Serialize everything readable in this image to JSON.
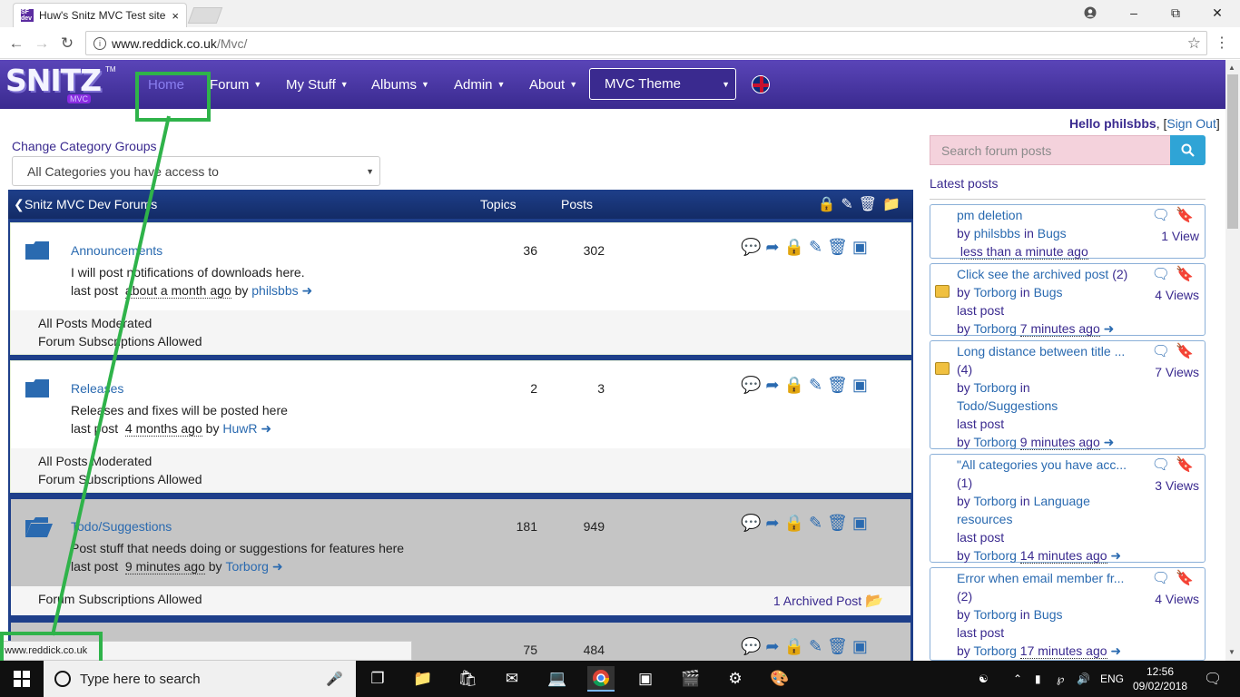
{
  "browser": {
    "tab_title": "Huw's Snitz MVC Test site",
    "tab_close": "×",
    "favicon": "SF dev",
    "url_host": "www.reddick.co.uk",
    "url_path": "/Mvc/",
    "status_url": "www.reddick.co.uk"
  },
  "site": {
    "logo_text": "SNITZ",
    "logo_sub": "MVC",
    "logo_tm": "TM",
    "nav": [
      {
        "label": "Home"
      },
      {
        "label": "Forum"
      },
      {
        "label": "My Stuff"
      },
      {
        "label": "Albums"
      },
      {
        "label": "Admin"
      },
      {
        "label": "About"
      }
    ],
    "theme_select": "MVC Theme"
  },
  "main": {
    "change_category_label": "Change Category Groups",
    "category_select": "All Categories you have access to",
    "forum_group_title": "Snitz MVC Dev Forums",
    "col_topics": "Topics",
    "col_posts": "Posts",
    "forums": [
      {
        "name": "Announcements",
        "description": "I will post notifications of downloads here.",
        "last_post_label": "last post",
        "last_post_time": "about a month ago",
        "by": "by",
        "last_post_user": "philsbbs",
        "topics": "36",
        "posts": "302",
        "footer_lines": [
          "All Posts Moderated",
          "Forum Subscriptions Allowed"
        ]
      },
      {
        "name": "Releases",
        "description": "Releases and fixes will be posted here",
        "last_post_label": "last post",
        "last_post_time": "4 months ago",
        "by": "by",
        "last_post_user": "HuwR",
        "topics": "2",
        "posts": "3",
        "footer_lines": [
          "All Posts Moderated",
          "Forum Subscriptions Allowed"
        ]
      },
      {
        "name": "Todo/Suggestions",
        "description": "Post stuff that needs doing or suggestions for features here",
        "last_post_label": "last post",
        "last_post_time": "9 minutes ago",
        "by": "by",
        "last_post_user": "Torborg",
        "topics": "181",
        "posts": "949",
        "footer_lines": [
          "Forum Subscriptions Allowed"
        ],
        "archived": "1 Archived Post"
      },
      {
        "name": "",
        "topics": "75",
        "posts": "484"
      }
    ]
  },
  "sidebar": {
    "hello": "Hello",
    "user": "philsbbs",
    "signout": "Sign Out",
    "search_placeholder": "Search forum posts",
    "latest_title": "Latest posts",
    "posts": [
      {
        "title": "pm deletion",
        "count": "",
        "by": "by",
        "user": "philsbbs",
        "in": "in",
        "forum": "Bugs",
        "last": "",
        "last_time": "less than a minute ago",
        "views": "1 View"
      },
      {
        "title": "Click see the archived post",
        "count": "(2)",
        "by": "by",
        "user": "Torborg",
        "in": "in",
        "forum": "Bugs",
        "last": "last post",
        "last_time": "7 minutes ago",
        "views": "4 Views"
      },
      {
        "title": "Long distance between title ...",
        "count": "(4)",
        "by": "by",
        "user": "Torborg",
        "in": "in",
        "forum": "Todo/Suggestions",
        "last": "last post",
        "last_time": "9 minutes ago",
        "views": "7 Views"
      },
      {
        "title": "\"All categories you have acc...",
        "count": "(1)",
        "by": "by",
        "user": "Torborg",
        "in": "in",
        "forum": "Language resources",
        "last": "last post",
        "last_time": "14 minutes ago",
        "views": "3 Views"
      },
      {
        "title": "Error when email member fr...",
        "count": "(2)",
        "by": "by",
        "user": "Torborg",
        "in": "in",
        "forum": "Bugs",
        "last": "last post",
        "last_time": "17 minutes ago",
        "views": "4 Views"
      }
    ]
  },
  "taskbar": {
    "search_text": "Type here to search",
    "lang": "ENG",
    "time": "12:56",
    "date": "09/02/2018"
  },
  "colors": {
    "header": "#3a2a8f",
    "forum_bar": "#1e3f8a",
    "link": "#2a6ab0",
    "annotation": "#2fb34a",
    "search_bg": "#f4d2dc",
    "search_btn": "#2fa4d6"
  }
}
